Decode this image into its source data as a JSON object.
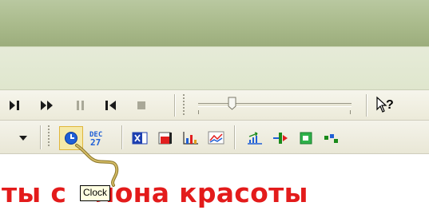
{
  "media_toolbar": {
    "buttons": [
      {
        "name": "play-step-button",
        "icon": "step-forward-icon"
      },
      {
        "name": "fast-forward-button",
        "icon": "fast-forward-icon"
      },
      {
        "name": "pause-button",
        "icon": "pause-icon"
      },
      {
        "name": "rewind-button",
        "icon": "skip-back-icon"
      },
      {
        "name": "stop-button",
        "icon": "stop-icon"
      }
    ],
    "slider_level": 0.22,
    "help_icon_text": "?"
  },
  "insert_toolbar": {
    "dropdown_icon": "chevron-down-icon",
    "clock_label": "Clock",
    "date_icon_month": "DEC",
    "date_icon_day": "27"
  },
  "tooltip": {
    "text": "Clock"
  },
  "heading": {
    "text_left": "ты с",
    "text_right": "лона красоты"
  },
  "colors": {
    "heading": "#e31b1b",
    "tooltip_bg": "#ffffe1",
    "accent_blue": "#1f5fd6"
  }
}
